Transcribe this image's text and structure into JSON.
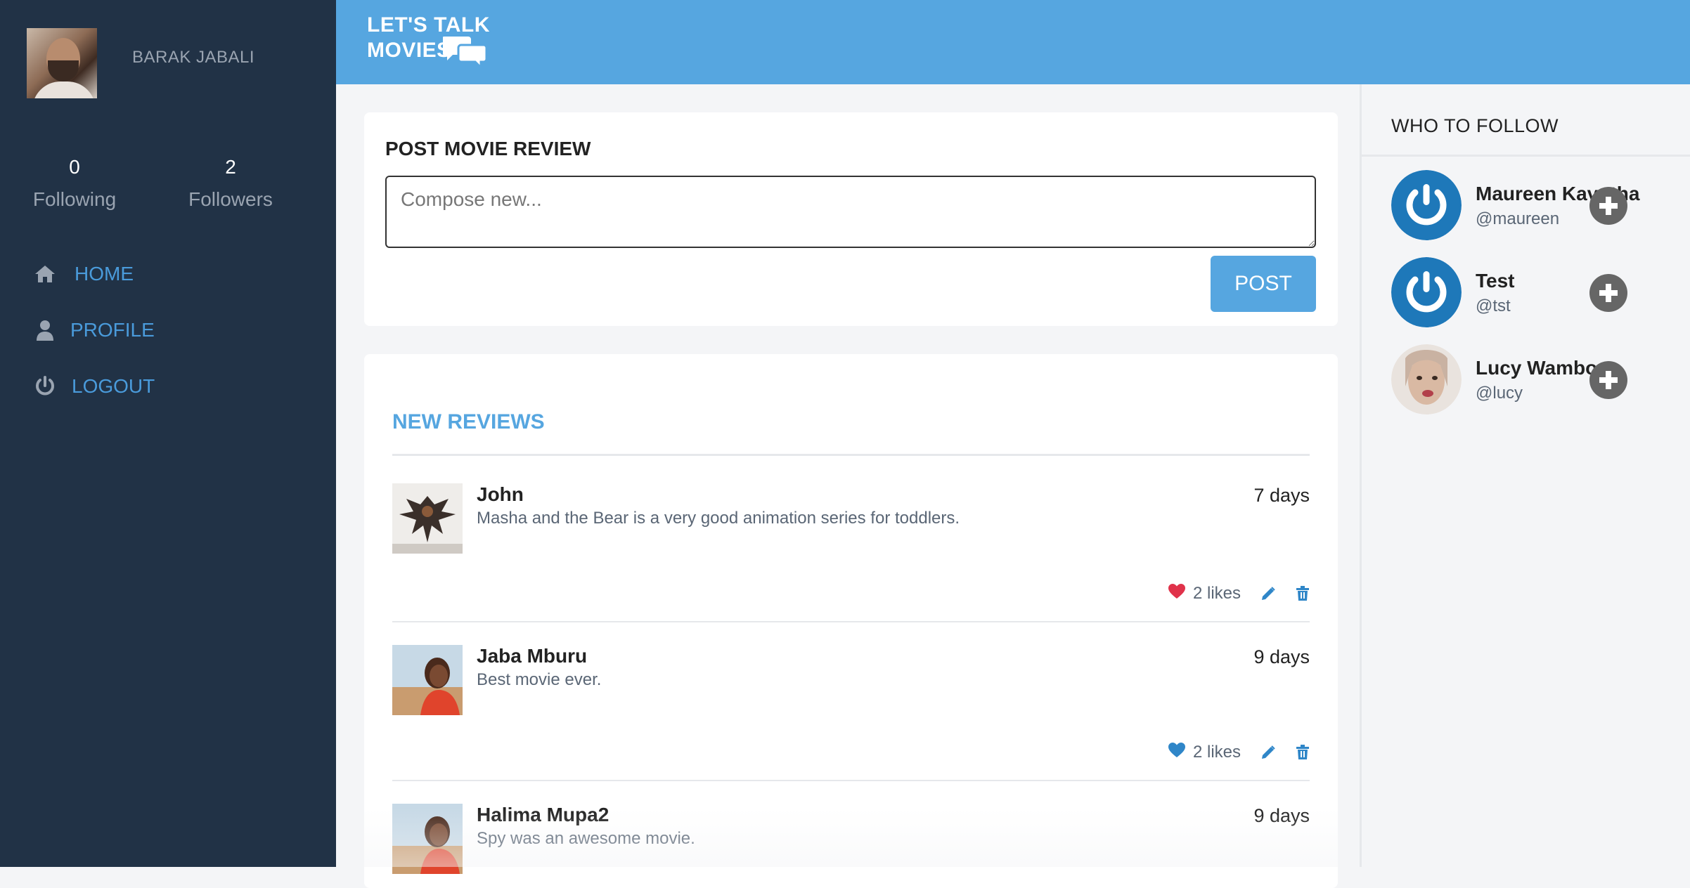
{
  "app": {
    "logo_line1": "LET'S TALK",
    "logo_line2": "MOVIES"
  },
  "sidebar": {
    "username": "BARAK JABALI",
    "stats": {
      "following_count": "0",
      "following_label": "Following",
      "followers_count": "2",
      "followers_label": "Followers"
    },
    "nav": [
      {
        "label": "HOME",
        "icon": "home-icon"
      },
      {
        "label": "PROFILE",
        "icon": "user-icon"
      },
      {
        "label": "LOGOUT",
        "icon": "power-icon"
      }
    ]
  },
  "post_review": {
    "title": "POST MOVIE REVIEW",
    "placeholder": "Compose new...",
    "button_label": "POST"
  },
  "reviews": {
    "title": "NEW REVIEWS",
    "items": [
      {
        "name": "John",
        "text": "Masha and the Bear is a very good animation series for toddlers.",
        "time": "7 days",
        "likes": "2 likes",
        "liked": true
      },
      {
        "name": "Jaba Mburu",
        "text": "Best movie ever.",
        "time": "9 days",
        "likes": "2 likes",
        "liked": false
      },
      {
        "name": "Halima Mupa2",
        "text": "Spy was an awesome movie.",
        "time": "9 days"
      }
    ]
  },
  "who_to_follow": {
    "title": "WHO TO FOLLOW",
    "users": [
      {
        "name": "Maureen Kavutha",
        "handle": "@maureen"
      },
      {
        "name": "Test",
        "handle": "@tst"
      },
      {
        "name": "Lucy Wambo",
        "handle": "@lucy"
      }
    ]
  },
  "colors": {
    "accent": "#56a6e0",
    "sidebar_bg": "#213246",
    "nav_text": "#4a9bdb",
    "heart_liked": "#e0324a",
    "heart_default": "#2f86c8",
    "action_icon": "#2f86c8"
  }
}
